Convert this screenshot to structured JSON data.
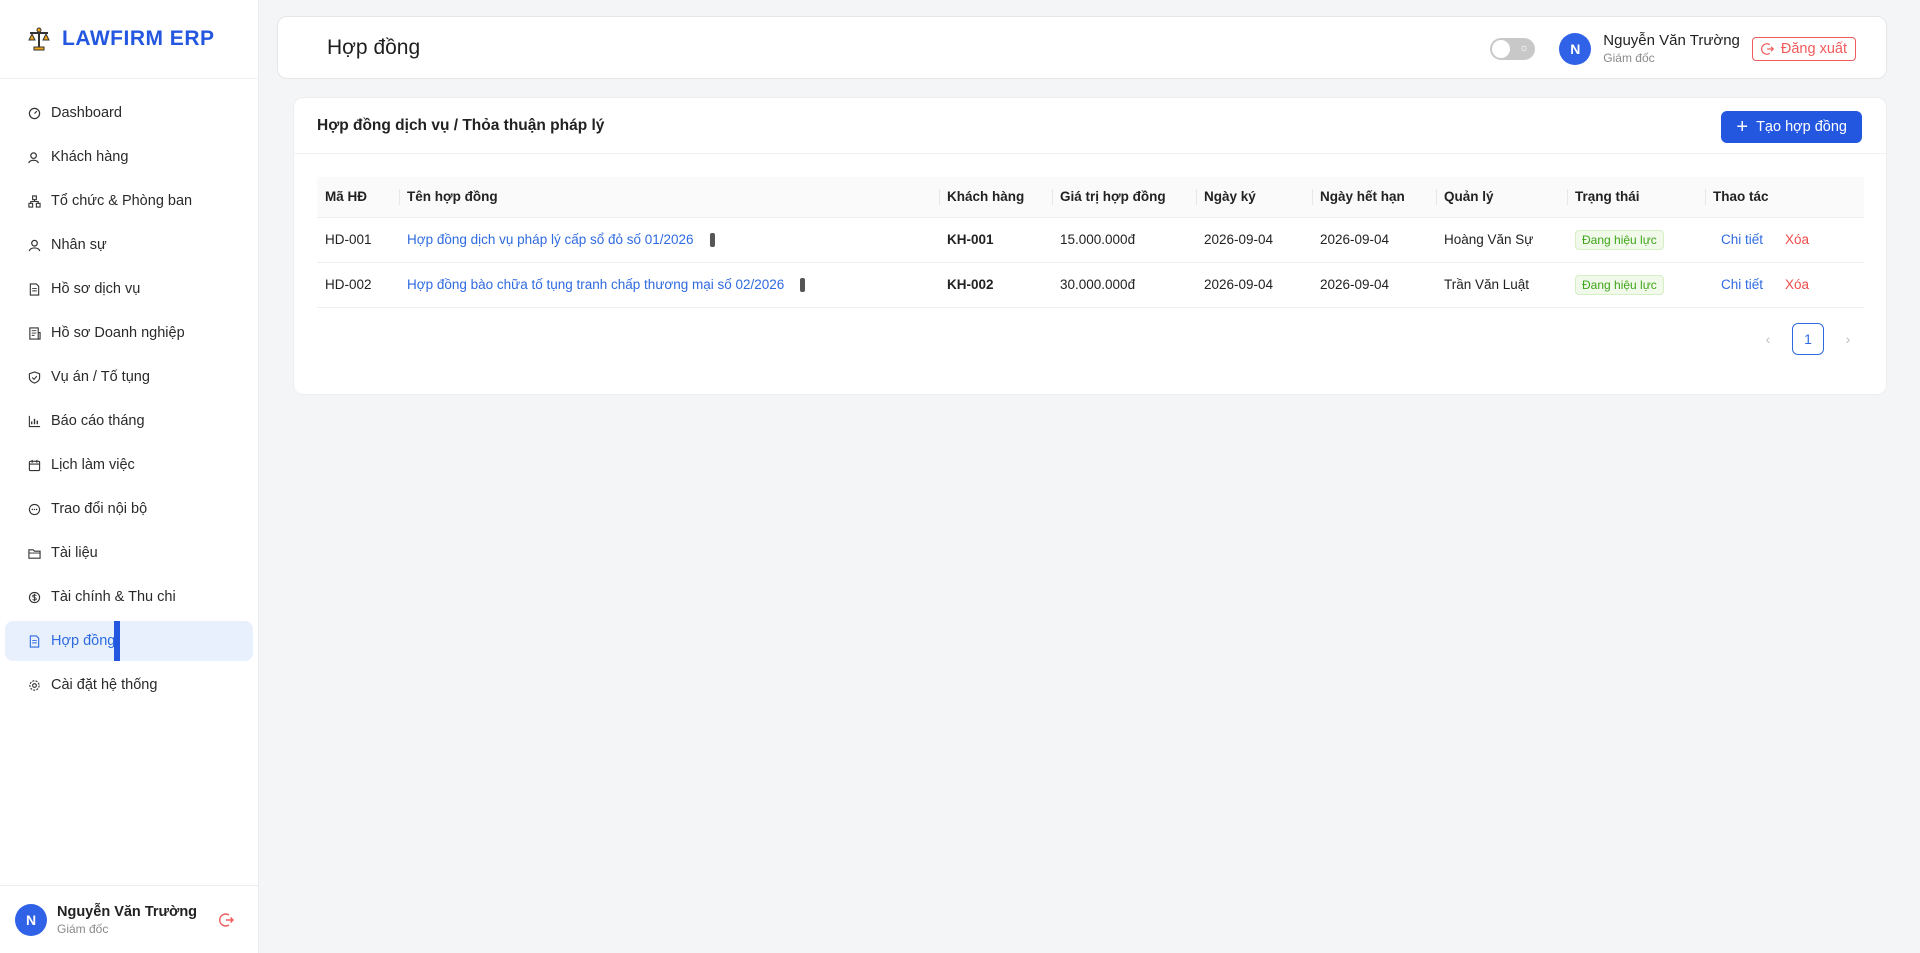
{
  "brand": {
    "name": "LAWFIRM ERP",
    "logo_icon": "scales-icon"
  },
  "sidebar": {
    "items": [
      {
        "label": "Dashboard",
        "icon": "dashboard-icon"
      },
      {
        "label": "Khách hàng",
        "icon": "customer-icon"
      },
      {
        "label": "Tổ chức & Phòng ban",
        "icon": "org-icon"
      },
      {
        "label": "Nhân sự",
        "icon": "user-icon"
      },
      {
        "label": "Hồ sơ dịch vụ",
        "icon": "file-icon"
      },
      {
        "label": "Hồ sơ Doanh nghiệp",
        "icon": "building-doc-icon"
      },
      {
        "label": "Vụ án / Tố tụng",
        "icon": "shield-icon"
      },
      {
        "label": "Báo cáo tháng",
        "icon": "chart-icon"
      },
      {
        "label": "Lịch làm việc",
        "icon": "calendar-icon"
      },
      {
        "label": "Trao đổi nội bộ",
        "icon": "chat-icon"
      },
      {
        "label": "Tài liệu",
        "icon": "folder-icon"
      },
      {
        "label": "Tài chính & Thu chi",
        "icon": "dollar-icon"
      },
      {
        "label": "Hợp đồng",
        "icon": "contract-icon",
        "active": true
      },
      {
        "label": "Cài đặt hệ thống",
        "icon": "gear-icon"
      }
    ],
    "user": {
      "initial": "N",
      "name": "Nguyễn Văn Trường",
      "role": "Giám đốc"
    }
  },
  "header": {
    "title": "Hợp đồng",
    "user": {
      "initial": "N",
      "name": "Nguyễn Văn Trường",
      "role": "Giám đốc"
    },
    "logout_label": "Đăng xuất"
  },
  "card": {
    "title": "Hợp đồng dịch vụ / Thỏa thuận pháp lý",
    "create_label": "Tạo hợp đồng",
    "columns": [
      "Mã HĐ",
      "Tên hợp đồng",
      "Khách hàng",
      "Giá trị hợp đồng",
      "Ngày ký",
      "Ngày hết hạn",
      "Quản lý",
      "Trạng thái",
      "Thao tác"
    ],
    "rows": [
      {
        "code": "HD-001",
        "name": "Hợp đồng dịch vụ pháp lý cấp sổ đỏ số 01/2026",
        "customer": "KH-001",
        "value": "15.000.000đ",
        "signed": "2026-09-04",
        "expires": "2026-09-04",
        "manager": "Hoàng Văn Sự",
        "status": "Đang hiệu lực",
        "detail": "Chi tiết",
        "delete": "Xóa"
      },
      {
        "code": "HD-002",
        "name": "Hợp đồng bào chữa tố tụng tranh chấp thương mại số 02/2026",
        "customer": "KH-002",
        "value": "30.000.000đ",
        "signed": "2026-09-04",
        "expires": "2026-09-04",
        "manager": "Trần Văn Luật",
        "status": "Đang hiệu lực",
        "detail": "Chi tiết",
        "delete": "Xóa"
      }
    ],
    "pagination": {
      "current": "1"
    }
  },
  "colors": {
    "accent": "#2457e0",
    "link": "#2f6be0",
    "danger": "#ef4b4b",
    "success": "#3fa51a"
  }
}
